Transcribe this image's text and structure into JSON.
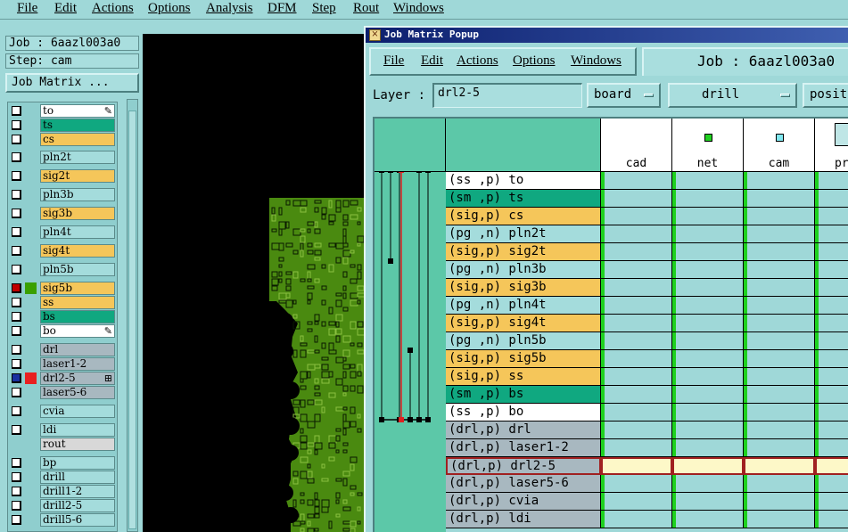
{
  "menubar": {
    "items": [
      "File",
      "Edit",
      "Actions",
      "Options",
      "Analysis",
      "DFM",
      "Step",
      "Rout",
      "Windows"
    ]
  },
  "left_panel": {
    "job_label": "Job : 6aazl003a0",
    "step_label": "Step: cam",
    "job_matrix_button": "Job Matrix ..."
  },
  "layers": [
    {
      "name": "to",
      "color": "#ffffff",
      "marker": "✎",
      "cb": "white"
    },
    {
      "name": "ts",
      "color": "#10a880",
      "cb": "white"
    },
    {
      "name": "cs",
      "color": "#f5c65a",
      "cb": "white"
    },
    {
      "name": "pln2t",
      "color": "#a4dcdc",
      "cb": "white"
    },
    {
      "name": "sig2t",
      "color": "#f5c65a",
      "cb": "white"
    },
    {
      "name": "pln3b",
      "color": "#a4dcdc",
      "cb": "white"
    },
    {
      "name": "sig3b",
      "color": "#f5c65a",
      "cb": "white"
    },
    {
      "name": "pln4t",
      "color": "#a4dcdc",
      "cb": "white"
    },
    {
      "name": "sig4t",
      "color": "#f5c65a",
      "cb": "white"
    },
    {
      "name": "pln5b",
      "color": "#a4dcdc",
      "cb": "white"
    },
    {
      "name": "sig5b",
      "color": "#f5c65a",
      "cb": "red",
      "swatch": "#3aa000"
    },
    {
      "name": "ss",
      "color": "#f5c65a",
      "cb": "white"
    },
    {
      "name": "bs",
      "color": "#10a880",
      "cb": "white"
    },
    {
      "name": "bo",
      "color": "#ffffff",
      "marker": "✎",
      "cb": "white"
    },
    {
      "name": "drl",
      "color": "#a8b8c0",
      "cb": "white"
    },
    {
      "name": "laser1-2",
      "color": "#a8b8c0",
      "cb": "white"
    },
    {
      "name": "drl2-5",
      "color": "#a8b8c0",
      "marker": "⊞",
      "cb": "blue",
      "swatch": "#e82020"
    },
    {
      "name": "laser5-6",
      "color": "#a8b8c0",
      "cb": "white"
    },
    {
      "name": "cvia",
      "color": "#a4dcdc",
      "cb": "white"
    },
    {
      "name": "ldi",
      "color": "#a4dcdc",
      "cb": "white"
    },
    {
      "name": "rout",
      "color": "#d8d8d8",
      "cb": "none"
    },
    {
      "name": "bp",
      "color": "#a4dcdc",
      "cb": "white"
    },
    {
      "name": "drill",
      "color": "#a4dcdc",
      "cb": "white"
    },
    {
      "name": "drill1-2",
      "color": "#a4dcdc",
      "cb": "white"
    },
    {
      "name": "drill2-5",
      "color": "#a4dcdc",
      "cb": "white"
    },
    {
      "name": "drill5-6",
      "color": "#a4dcdc",
      "cb": "white"
    }
  ],
  "popup": {
    "title": "Job Matrix Popup",
    "menu": [
      "File",
      "Edit",
      "Actions",
      "Options",
      "Windows"
    ],
    "job_label": "Job : 6aazl003a0",
    "layer_label": "Layer :",
    "layer_value": "drl2-5",
    "context_dropdown": "board",
    "type_dropdown": "drill",
    "polarity_dropdown": "posit"
  },
  "matrix": {
    "steps": [
      {
        "name": "cad",
        "icon": "none"
      },
      {
        "name": "net",
        "icon": "green"
      },
      {
        "name": "cam",
        "icon": "cyan"
      },
      {
        "name": "pr",
        "icon": "grid"
      }
    ],
    "rows": [
      {
        "label": "(ss ,p) to",
        "color": "#ffffff"
      },
      {
        "label": "(sm ,p) ts",
        "color": "#10a880"
      },
      {
        "label": "(sig,p) cs",
        "color": "#f5c65a"
      },
      {
        "label": "(pg ,n) pln2t",
        "color": "#a4dcdc"
      },
      {
        "label": "(sig,p) sig2t",
        "color": "#f5c65a"
      },
      {
        "label": "(pg ,n) pln3b",
        "color": "#a4dcdc"
      },
      {
        "label": "(sig,p) sig3b",
        "color": "#f5c65a"
      },
      {
        "label": "(pg ,n) pln4t",
        "color": "#a4dcdc"
      },
      {
        "label": "(sig,p) sig4t",
        "color": "#f5c65a"
      },
      {
        "label": "(pg ,n) pln5b",
        "color": "#a4dcdc"
      },
      {
        "label": "(sig,p) sig5b",
        "color": "#f5c65a"
      },
      {
        "label": "(sig,p) ss",
        "color": "#f5c65a"
      },
      {
        "label": "(sm ,p) bs",
        "color": "#10a880"
      },
      {
        "label": "(ss ,p) bo",
        "color": "#ffffff"
      },
      {
        "label": "(drl,p) drl",
        "color": "#a8b8c0"
      },
      {
        "label": "(drl,p) laser1-2",
        "color": "#a8b8c0"
      },
      {
        "label": "(drl,p) drl2-5",
        "color": "#a8b8c0",
        "selected": true
      },
      {
        "label": "(drl,p) laser5-6",
        "color": "#a8b8c0"
      },
      {
        "label": "(drl,p) cvia",
        "color": "#a8b8c0"
      },
      {
        "label": "(drl,p) ldi",
        "color": "#a8b8c0"
      }
    ]
  }
}
